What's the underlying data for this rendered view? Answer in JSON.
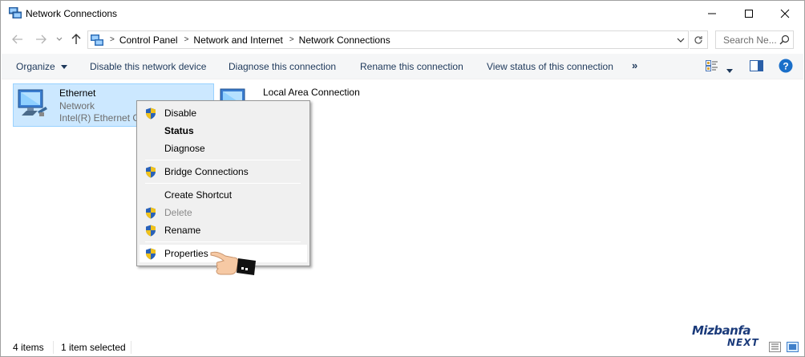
{
  "window": {
    "title": "Network Connections",
    "minimize_glyph": "—",
    "maximize_glyph": "☐",
    "close_glyph": "✕"
  },
  "address": {
    "crumbs": [
      "Control Panel",
      "Network and Internet",
      "Network Connections"
    ],
    "search_placeholder": "Search Ne..."
  },
  "commands": {
    "organize": "Organize",
    "disable": "Disable this network device",
    "diagnose": "Diagnose this connection",
    "rename": "Rename this connection",
    "view_status": "View status of this connection",
    "more": "»"
  },
  "items": [
    {
      "name": "Ethernet",
      "status": "Network",
      "device": "Intel(R) Ethernet Connection",
      "selected": true
    },
    {
      "name": "Local Area Connection",
      "selected": false
    }
  ],
  "context_menu": {
    "items": [
      {
        "label": "Disable",
        "shield": true,
        "bold": false,
        "disabled": false
      },
      {
        "label": "Status",
        "shield": false,
        "bold": true,
        "disabled": false
      },
      {
        "label": "Diagnose",
        "shield": false,
        "bold": false,
        "disabled": false
      },
      {
        "label": "Bridge Connections",
        "shield": true,
        "bold": false,
        "disabled": false
      },
      {
        "label": "Create Shortcut",
        "shield": false,
        "bold": false,
        "disabled": false
      },
      {
        "label": "Delete",
        "shield": true,
        "bold": false,
        "disabled": true
      },
      {
        "label": "Rename",
        "shield": true,
        "bold": false,
        "disabled": false
      },
      {
        "label": "Properties",
        "shield": true,
        "bold": false,
        "disabled": false,
        "hover": true
      }
    ]
  },
  "statusbar": {
    "count": "4 items",
    "selected": "1 item selected"
  },
  "watermark": {
    "name": "Mizbanfa",
    "sub": "NEXT"
  },
  "colors": {
    "selection_bg": "#cce8ff",
    "selection_border": "#99d1ff",
    "command_text": "#1e395b",
    "help_blue": "#1a6fc9"
  }
}
